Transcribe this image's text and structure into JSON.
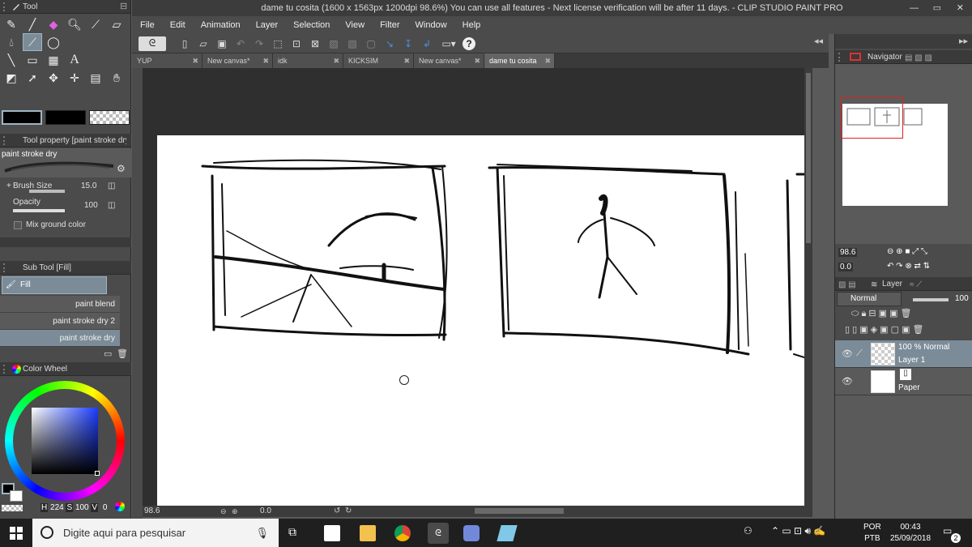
{
  "window": {
    "title": "dame tu cosita (1600 x 1563px 1200dpi 98.6%)  You can use all features - Next license verification will be after 11 days. - CLIP STUDIO PAINT PRO"
  },
  "menu": [
    "File",
    "Edit",
    "Animation",
    "Layer",
    "Selection",
    "View",
    "Filter",
    "Window",
    "Help"
  ],
  "tabs": [
    {
      "label": "YUP"
    },
    {
      "label": "New canvas*"
    },
    {
      "label": "idk"
    },
    {
      "label": "KICKSIM"
    },
    {
      "label": "New canvas*"
    },
    {
      "label": "dame tu cosita"
    }
  ],
  "tool_panel": {
    "title": "Tool"
  },
  "tool_property": {
    "title": "Tool property [paint stroke dry]",
    "preset": "paint stroke dry",
    "brush_size_label": "Brush Size",
    "brush_size_value": "15.0",
    "opacity_label": "Opacity",
    "opacity_value": "100",
    "mix_ground_color_label": "Mix ground color"
  },
  "sub_tool": {
    "title": "Sub Tool [Fill]",
    "group": "Fill",
    "items": [
      "paint blend",
      "paint stroke dry 2",
      "paint stroke dry"
    ]
  },
  "color_wheel": {
    "title": "Color Wheel",
    "h_label": "H",
    "h_value": "224",
    "s_label": "S",
    "s_value": "100",
    "v_label": "V",
    "v_value": "0",
    "main_color": "#000000",
    "sub_color": "#ffffff"
  },
  "status": {
    "zoom": "98.6",
    "rotation": "0.0"
  },
  "navigator": {
    "title": "Navigator",
    "zoom": "98.6",
    "rotation": "0.0"
  },
  "layer_panel": {
    "title": "Layer",
    "blend_mode": "Normal",
    "opacity": "100",
    "layers": [
      {
        "line1": "100 % Normal",
        "line2": "Layer 1"
      },
      {
        "line1": "",
        "line2": "Paper"
      }
    ]
  },
  "taskbar": {
    "search_placeholder": "Digite aqui para pesquisar",
    "lang1": "POR",
    "lang2": "PTB",
    "time": "00:43",
    "date": "25/09/2018",
    "notifications": "2"
  }
}
